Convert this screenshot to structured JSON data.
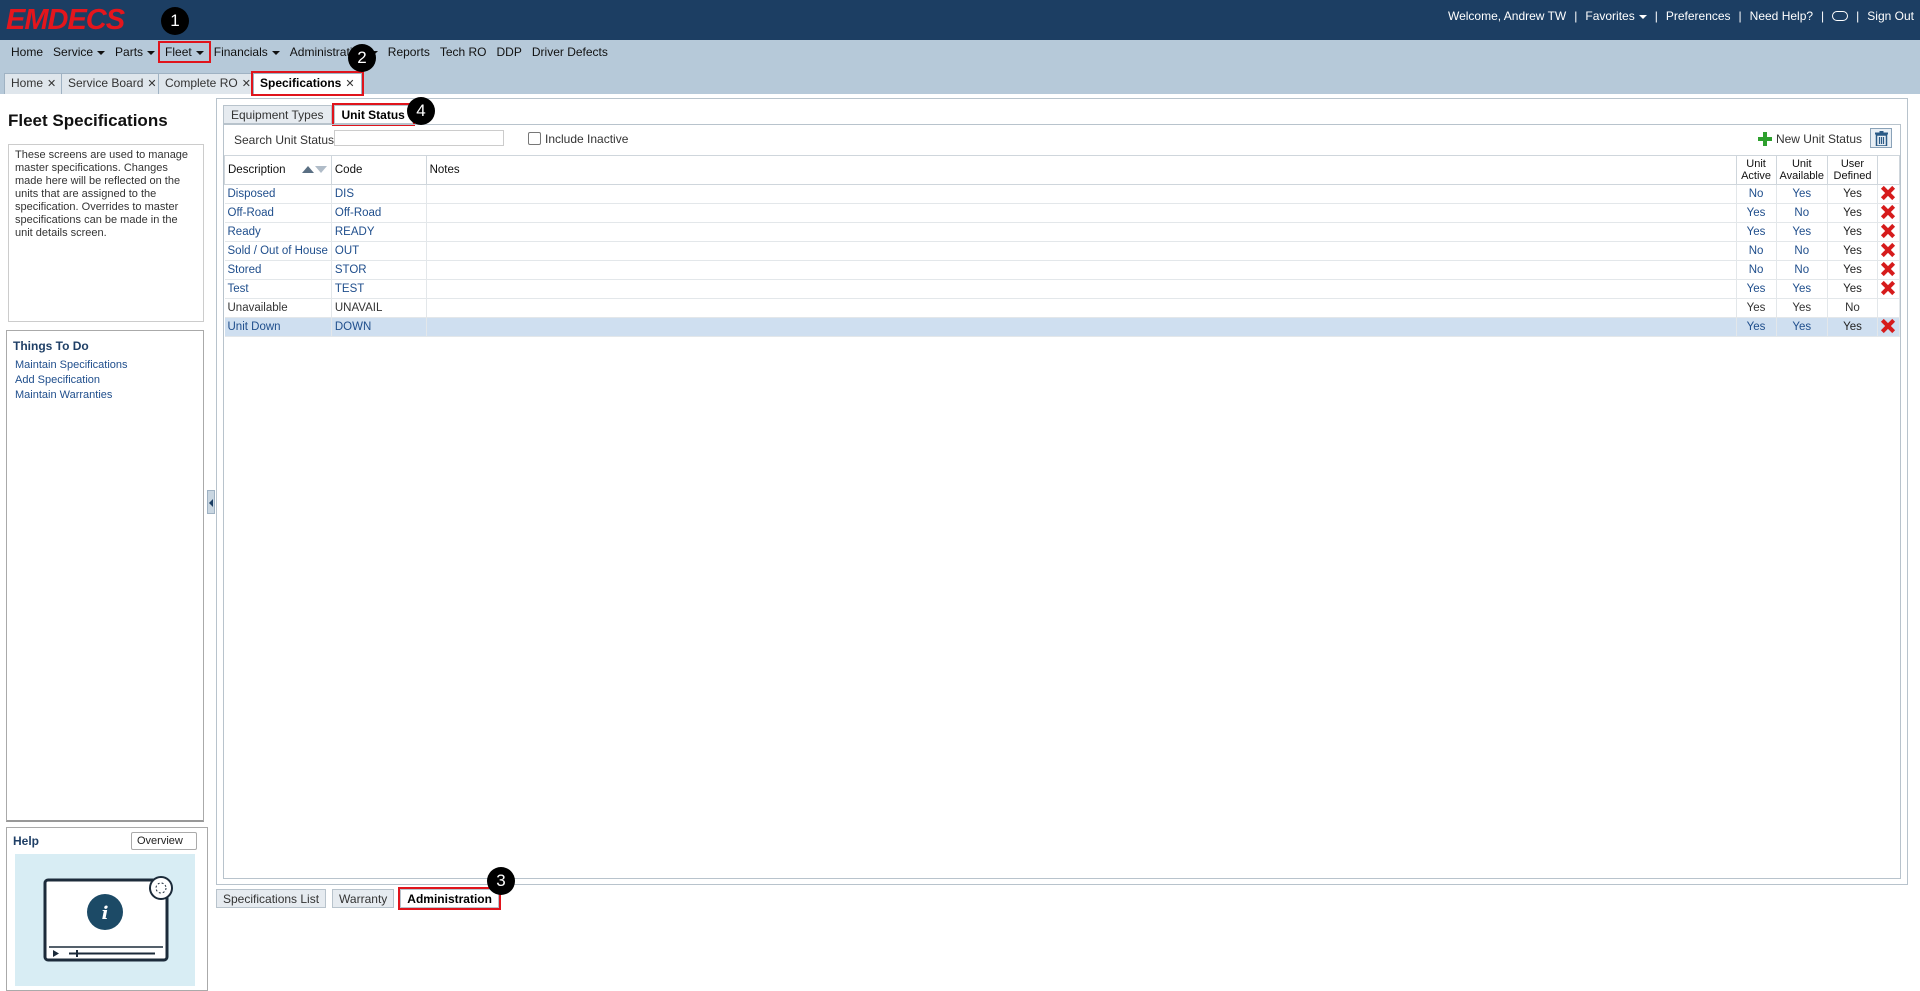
{
  "app": {
    "logo": "EMDECS"
  },
  "topbar": {
    "welcome": "Welcome, Andrew TW",
    "favorites": "Favorites",
    "preferences": "Preferences",
    "help": "Need Help?",
    "signout": "Sign Out"
  },
  "nav": [
    "Home",
    "Service",
    "Parts",
    "Fleet",
    "Financials",
    "Administration",
    "Reports",
    "Tech RO",
    "DDP",
    "Driver Defects"
  ],
  "doc_tabs": [
    "Home",
    "Service Board",
    "Complete RO",
    "Specifications"
  ],
  "left": {
    "title": "Fleet Specifications",
    "description": "These screens are used to manage master specifications. Changes made here will be reflected on the units that are assigned to the specification. Overrides to master specifications can be made in the unit details screen.",
    "todo_title": "Things To Do",
    "todo_links": [
      "Maintain Specifications",
      "Add Specification",
      "Maintain Warranties"
    ],
    "help_title": "Help",
    "help_select": "Overview"
  },
  "inner_tabs": [
    "Equipment Types",
    "Unit Status"
  ],
  "toolbar": {
    "search_label": "Search Unit Status:",
    "search_value": "",
    "include_inactive": "Include Inactive",
    "new_button": "New Unit Status"
  },
  "table": {
    "headers": {
      "description": "Description",
      "code": "Code",
      "notes": "Notes",
      "active_l1": "Unit",
      "active_l2": "Active",
      "available_l1": "Unit",
      "available_l2": "Available",
      "user_l1": "User",
      "user_l2": "Defined"
    },
    "rows": [
      {
        "description": "Disposed",
        "code": "DIS",
        "notes": "",
        "active": "No",
        "available": "Yes",
        "user": "Yes",
        "deletable": true
      },
      {
        "description": "Off-Road",
        "code": "Off-Road",
        "notes": "",
        "active": "Yes",
        "available": "No",
        "user": "Yes",
        "deletable": true
      },
      {
        "description": "Ready",
        "code": "READY",
        "notes": "",
        "active": "Yes",
        "available": "Yes",
        "user": "Yes",
        "deletable": true
      },
      {
        "description": "Sold / Out of House",
        "code": "OUT",
        "notes": "",
        "active": "No",
        "available": "No",
        "user": "Yes",
        "deletable": true
      },
      {
        "description": "Stored",
        "code": "STOR",
        "notes": "",
        "active": "No",
        "available": "No",
        "user": "Yes",
        "deletable": true
      },
      {
        "description": "Test",
        "code": "TEST",
        "notes": "",
        "active": "Yes",
        "available": "Yes",
        "user": "Yes",
        "deletable": true
      },
      {
        "description": "Unavailable",
        "code": "UNAVAIL",
        "notes": "",
        "active": "Yes",
        "available": "Yes",
        "user": "No",
        "deletable": false
      },
      {
        "description": "Unit Down",
        "code": "DOWN",
        "notes": "",
        "active": "Yes",
        "available": "Yes",
        "user": "Yes",
        "deletable": true
      }
    ]
  },
  "bottom_tabs": [
    "Specifications List",
    "Warranty",
    "Administration"
  ],
  "callouts": [
    "1",
    "2",
    "3",
    "4"
  ],
  "colors": {
    "header_bg": "#1c3e63",
    "nav_bg": "#b6c9d9",
    "logo_red": "#e4161d",
    "link_blue": "#1f4e8c",
    "highlight_red": "#e0141c",
    "selected_row": "#cfdff0"
  }
}
